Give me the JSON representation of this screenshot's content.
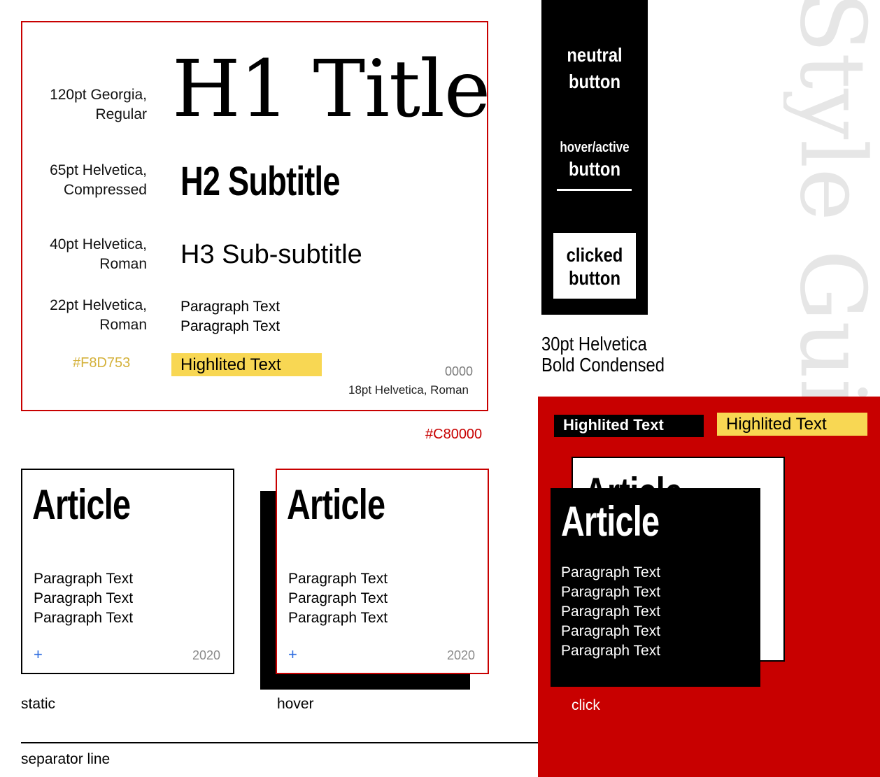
{
  "title": "Style Guide",
  "typography": {
    "h1": {
      "spec": [
        "120pt Georgia,",
        "Regular"
      ],
      "sample": "H1 Title"
    },
    "h2": {
      "spec": [
        "65pt Helvetica,",
        "Compressed"
      ],
      "sample": "H2 Subtitle"
    },
    "h3": {
      "spec": [
        "40pt Helvetica,",
        "Roman"
      ],
      "sample": "H3 Sub-subtitle"
    },
    "paragraph": {
      "spec": [
        "22pt Helvetica,",
        "Roman"
      ],
      "lines": [
        "Paragraph Text",
        "Paragraph Text"
      ]
    },
    "highlight": {
      "color_code": "#F8D753",
      "sample": "Highlited Text"
    },
    "small": {
      "code": "0000",
      "spec": "18pt Helvetica, Roman"
    },
    "frame_color_code": "#C80000"
  },
  "buttons": {
    "neutral": [
      "neutral",
      "button"
    ],
    "hover": [
      "hover/active",
      "button"
    ],
    "clicked": [
      "clicked",
      "button"
    ],
    "spec": [
      "30pt Helvetica",
      "Bold Condensed"
    ]
  },
  "cards": {
    "static": {
      "title": "Article",
      "paragraphs": [
        "Paragraph Text",
        "Paragraph Text",
        "Paragraph Text"
      ],
      "plus": "+",
      "year": "2020",
      "label": "static"
    },
    "hover": {
      "title": "Article",
      "paragraphs": [
        "Paragraph Text",
        "Paragraph Text",
        "Paragraph Text"
      ],
      "plus": "+",
      "year": "2020",
      "label": "hover"
    },
    "click": {
      "back_title": "Article",
      "title": "Article",
      "paragraphs": [
        "Paragraph Text",
        "Paragraph Text",
        "Paragraph Text",
        "Paragraph Text",
        "Paragraph Text"
      ],
      "label": "click"
    }
  },
  "highlights": {
    "black": "Highlited Text",
    "yellow": "Highlited Text"
  },
  "separator": {
    "label": "separator line"
  },
  "colors": {
    "red": "#C80000",
    "yellow": "#F8D753",
    "black": "#000000",
    "white": "#FFFFFF",
    "plus_blue": "#2F6DE0"
  }
}
